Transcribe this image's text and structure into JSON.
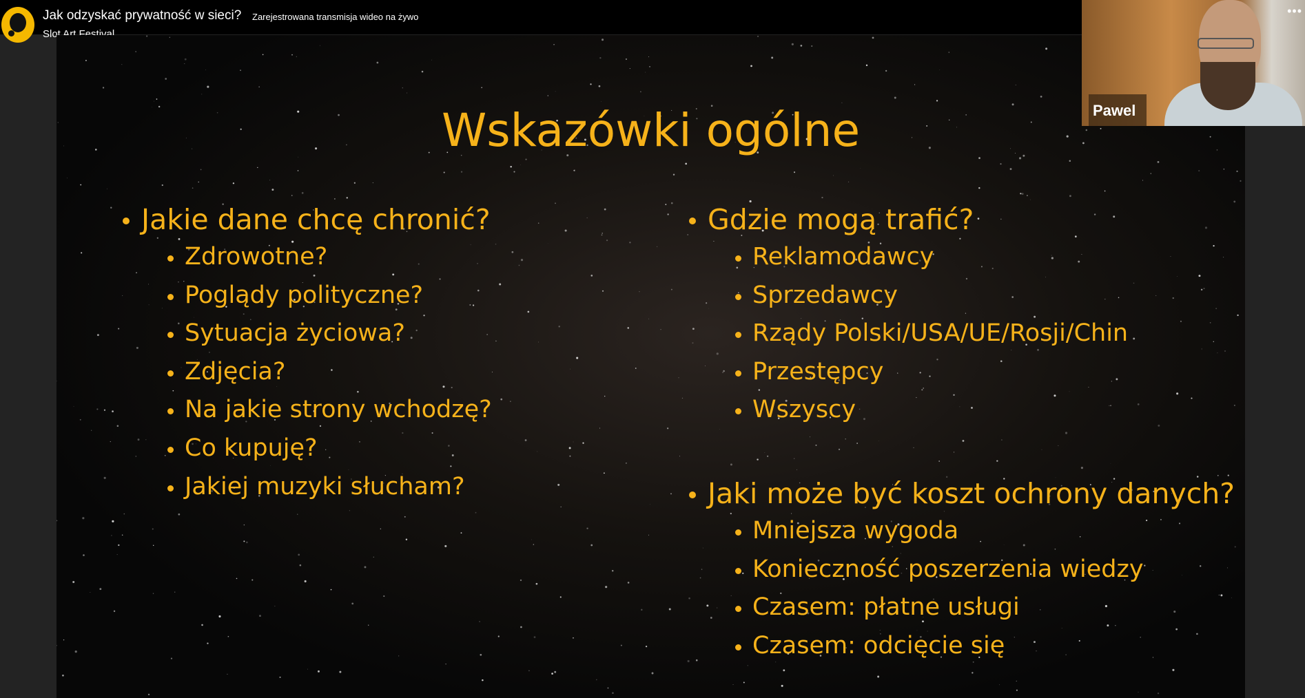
{
  "header": {
    "title": "Jak odzyskać prywatność w sieci?",
    "subtitle": "Zarejestrowana transmisja wideo na żywo",
    "organizer": "Slot Art Festival"
  },
  "video": {
    "participant_name": "Pawel",
    "more_icon": "•••"
  },
  "slide": {
    "title": "Wskazówki ogólne",
    "left": {
      "heading": "Jakie dane chcę chronić?",
      "items": [
        "Zdrowotne?",
        "Poglądy polityczne?",
        "Sytuacja życiowa?",
        "Zdjęcia?",
        "Na jakie strony wchodzę?",
        "Co kupuję?",
        "Jakiej muzyki słucham?"
      ]
    },
    "right1": {
      "heading": "Gdzie mogą trafić?",
      "items": [
        "Reklamodawcy",
        "Sprzedawcy",
        "Rządy Polski/USA/UE/Rosji/Chin",
        "Przestępcy",
        "Wszyscy"
      ]
    },
    "right2": {
      "heading": "Jaki może być koszt ochrony danych?",
      "items": [
        "Mniejsza wygoda",
        "Konieczność poszerzenia wiedzy",
        "Czasem: płatne usługi",
        "Czasem: odcięcie się"
      ]
    }
  },
  "colors": {
    "accent": "#f6b21a",
    "logo": "#f5b800"
  }
}
